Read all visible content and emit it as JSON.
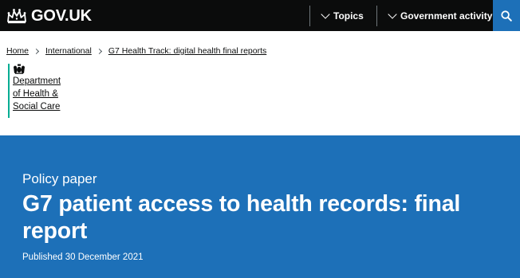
{
  "header": {
    "logo_text": "GOV.UK",
    "nav": [
      {
        "label": "Topics"
      },
      {
        "label": "Government activity"
      }
    ],
    "search_icon": "search-icon"
  },
  "breadcrumbs": [
    {
      "label": "Home"
    },
    {
      "label": "International"
    },
    {
      "label": "G7 Health Track: digital health final reports"
    }
  ],
  "organisation": {
    "lines": [
      "Department",
      "of Health &",
      "Social Care"
    ],
    "crest_icon": "royal-crest-icon",
    "accent_color": "#00ad93"
  },
  "hero": {
    "document_type": "Policy paper",
    "title": "G7 patient access to health records: final report",
    "published": "Published 30 December 2021"
  },
  "colors": {
    "header_bg": "#0b0c0c",
    "brand_blue": "#1d70b8"
  }
}
